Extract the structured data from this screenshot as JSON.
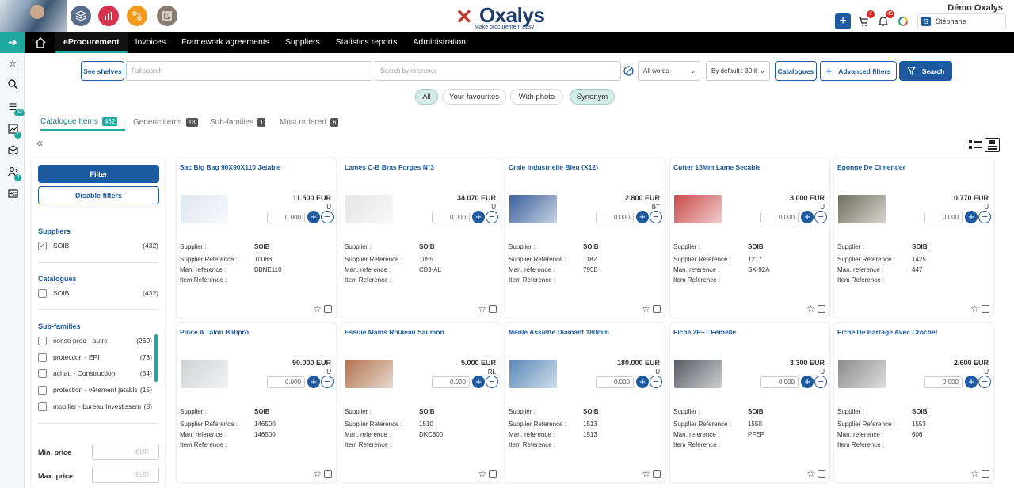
{
  "header": {
    "account": "Démo Oxalys",
    "logo_text": "Oxalys",
    "tagline": "Make procurement easy",
    "cart_badge": "2",
    "bell_badge": "45",
    "user_initial": "S",
    "user_name": "Stéphane"
  },
  "nav": {
    "items": [
      "eProcurement",
      "Invoices",
      "Framework agreements",
      "Suppliers",
      "Statistics reports",
      "Administration"
    ]
  },
  "sidebar": {
    "badges": [
      "22",
      "1",
      "4"
    ]
  },
  "search": {
    "see_shelves": "See shelves",
    "full_placeholder": "Full search",
    "ref_placeholder": "Search by reference",
    "words_select": "All words",
    "page_select": "By default : 30 it",
    "catalogues": "Catalogues",
    "advanced": "Advanced filters",
    "search": "Search"
  },
  "pills": [
    "All",
    "Your favourites",
    "With photo",
    "Synonym"
  ],
  "tabs": [
    {
      "label": "Catalogue Items",
      "count": "432"
    },
    {
      "label": "Generic items",
      "count": "18"
    },
    {
      "label": "Sub-families",
      "count": "1"
    },
    {
      "label": "Most ordered",
      "count": "6"
    }
  ],
  "filters": {
    "collapse": "«",
    "filter_btn": "Filter",
    "disable_btn": "Disable filters",
    "suppliers_title": "Suppliers",
    "suppliers": [
      {
        "label": "SOIB",
        "count": "(432)",
        "checked": "✓"
      }
    ],
    "catalogues_title": "Catalogues",
    "catalogues": [
      {
        "label": "SOIB",
        "count": "(432)",
        "checked": ""
      }
    ],
    "subfam_title": "Sub-families",
    "subfamilies": [
      {
        "label": "conso prod - autre",
        "count": "(269)"
      },
      {
        "label": "protection - EPI",
        "count": "(78)"
      },
      {
        "label": "achat. - Construction",
        "count": "(54)"
      },
      {
        "label": "protection - vêtement jetable",
        "count": "(15)"
      },
      {
        "label": "mobilier - bureau Investisseme",
        "count": "(8)"
      }
    ],
    "min_price": "Min. price",
    "max_price": "Max. price",
    "currency": "EUR"
  },
  "labels": {
    "supplier": "Supplier :",
    "supplier_ref": "Supplier Reference :",
    "man_ref": "Man. reference :",
    "item_ref": "Item Reference :"
  },
  "products": [
    {
      "title": "Sac Big Bag 90X90X110 Jetable",
      "price": "11.500 EUR",
      "unit": "U",
      "qty": "0.000",
      "supplier": "SOIB",
      "supplier_ref": "10088",
      "man_ref": "BBNE110",
      "item_ref": "",
      "color": "#dfe8ef"
    },
    {
      "title": "Lames C-B Bras Forges N°3",
      "price": "34.070 EUR",
      "unit": "U",
      "qty": "0.000",
      "supplier": "SOIB",
      "supplier_ref": "1055",
      "man_ref": "CB3-AL",
      "item_ref": "",
      "color": "#e6e6e6"
    },
    {
      "title": "Craie Industrielle Bleu (X12)",
      "price": "2.800 EUR",
      "unit": "BT",
      "qty": "0.000",
      "supplier": "SOIB",
      "supplier_ref": "1182",
      "man_ref": "795B",
      "item_ref": "",
      "color": "#3b5f9c"
    },
    {
      "title": "Cutter 18Mm Lame Secable",
      "price": "3.000 EUR",
      "unit": "U",
      "qty": "0.000",
      "supplier": "SOIB",
      "supplier_ref": "1217",
      "man_ref": "SX-92A",
      "item_ref": "",
      "color": "#c94b4b"
    },
    {
      "title": "Eponge De Cimentier",
      "price": "0.770 EUR",
      "unit": "U",
      "qty": "0.000",
      "supplier": "SOIB",
      "supplier_ref": "1425",
      "man_ref": "447",
      "item_ref": "",
      "color": "#6f6f5c"
    },
    {
      "title": "Pince A Talon Batipro",
      "price": "90.000 EUR",
      "unit": "U",
      "qty": "0.000",
      "supplier": "SOIB",
      "supplier_ref": "146500",
      "man_ref": "146500",
      "item_ref": "",
      "color": "#cfd2d4"
    },
    {
      "title": "Essuie Mains Rouleau Saumon",
      "price": "5.000 EUR",
      "unit": "RL",
      "qty": "0.000",
      "supplier": "SOIB",
      "supplier_ref": "1510",
      "man_ref": "DKC800",
      "item_ref": "",
      "color": "#b0734f"
    },
    {
      "title": "Meule Assiette Diamant 180mm",
      "price": "180.000 EUR",
      "unit": "U",
      "qty": "0.000",
      "supplier": "SOIB",
      "supplier_ref": "1513",
      "man_ref": "1513",
      "item_ref": "",
      "color": "#5a87b8"
    },
    {
      "title": "Fiche 2P+T Femelle",
      "price": "3.300 EUR",
      "unit": "U",
      "qty": "0.000",
      "supplier": "SOIB",
      "supplier_ref": "1550",
      "man_ref": "PFEP",
      "item_ref": "",
      "color": "#555a60"
    },
    {
      "title": "Fiche De Barrage Avec Crochet",
      "price": "2.600 EUR",
      "unit": "U",
      "qty": "0.000",
      "supplier": "SOIB",
      "supplier_ref": "1553",
      "man_ref": "606",
      "item_ref": "",
      "color": "#8b8b8b"
    }
  ]
}
